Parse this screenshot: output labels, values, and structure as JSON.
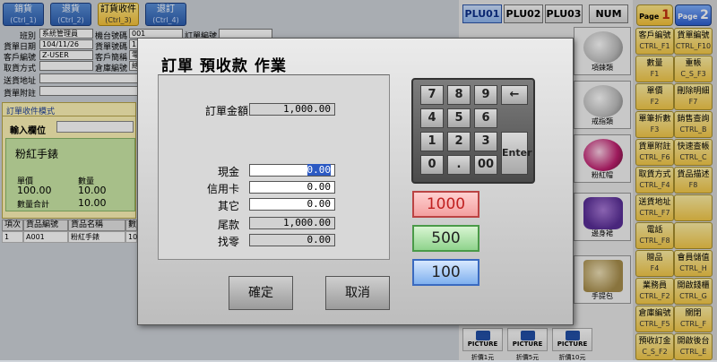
{
  "tabs": [
    {
      "label": "銷貨",
      "key": "(Ctrl_1)"
    },
    {
      "label": "退貨",
      "key": "(Ctrl_2)"
    },
    {
      "label": "訂貨收件",
      "key": "(Ctrl_3)"
    },
    {
      "label": "退訂",
      "key": "(Ctrl_4)"
    }
  ],
  "form": {
    "shift_label": "班別",
    "shift_value": "系統管理員",
    "machine_label": "機台號碼",
    "machine_value": "001",
    "order_no_label": "訂單編號",
    "date_label": "貨單日期",
    "date_value": "104/11/26",
    "sales_no_label": "貨單號碼",
    "sales_no_value": "1",
    "cust_label": "客戶編號",
    "cust_value": "Z-USER",
    "cust_name_label": "客戶簡稱",
    "cust_name_value": "零",
    "pickup_label": "取貨方式",
    "wh_label": "倉庫編號",
    "wh_value": "總",
    "addr_label": "送貨地址",
    "note_label": "貨單附註"
  },
  "order_panel": {
    "title": "訂單收件模式",
    "input_label": "輸入欄位",
    "item_name": "粉紅手錶",
    "price_label": "單價",
    "qty_label": "數量",
    "price_value": "100.00",
    "qty_value": "10.00",
    "qty_total_label": "數量合計",
    "qty_total_value": "10.00"
  },
  "grid": {
    "headers": [
      "項次",
      "貨品編號",
      "貨品名稱",
      "數"
    ],
    "row": [
      "1",
      "A001",
      "粉紅手錶",
      "10"
    ]
  },
  "plu_tabs": [
    "PLU01",
    "PLU02",
    "PLU03",
    "NUM"
  ],
  "page_buttons": [
    {
      "label": "Page",
      "num": "1"
    },
    {
      "label": "Page",
      "num": "2"
    }
  ],
  "products": [
    "項鍊類",
    "戒指類",
    "粉紅帽",
    "邊身裙",
    "手提包"
  ],
  "pictures": [
    {
      "label": "PICTURE",
      "caption": "折價1元"
    },
    {
      "label": "PICTURE",
      "caption": "折價5元"
    },
    {
      "label": "PICTURE",
      "caption": "折價10元"
    }
  ],
  "func_buttons": [
    [
      "客戶編號",
      "CTRL_F1",
      "貨單編號",
      "CTRL_F10"
    ],
    [
      "數量",
      "F1",
      "重帳",
      "C_S_F3"
    ],
    [
      "單價",
      "F2",
      "刪除明細",
      "F7"
    ],
    [
      "單筆折數",
      "F3",
      "銷售查詢",
      "CTRL_B"
    ],
    [
      "貨單附註",
      "CTRL_F6",
      "快速查帳",
      "CTRL_C"
    ],
    [
      "取貨方式",
      "CTRL_F4",
      "貨品描述",
      "F8"
    ],
    [
      "送貨地址",
      "CTRL_F7",
      "",
      ""
    ],
    [
      "電話",
      "CTRL_F8",
      "",
      ""
    ],
    [
      "贈品",
      "F4",
      "會員儲值",
      "CTRL_H"
    ],
    [
      "業務員",
      "CTRL_F2",
      "開啟錢櫃",
      "CTRL_G"
    ],
    [
      "倉庫編號",
      "CTRL_F5",
      "關閉",
      "CTRL_F"
    ],
    [
      "預收訂金",
      "C_S_F2",
      "開啟後台",
      "CTRL_E"
    ]
  ],
  "modal": {
    "title": "訂單 預收款 作業",
    "order_amount_label": "訂單金額",
    "order_amount": "1,000.00",
    "cash_label": "現金",
    "cash": "0.00",
    "card_label": "信用卡",
    "card": "0.00",
    "other_label": "其它",
    "other": "0.00",
    "balance_label": "尾款",
    "balance": "1,000.00",
    "change_label": "找零",
    "change": "0.00",
    "keys": [
      "7",
      "8",
      "9",
      "←",
      "4",
      "5",
      "6",
      "1",
      "2",
      "3",
      "0",
      ".",
      "00"
    ],
    "enter_label": "Enter",
    "quick_amounts": [
      "1000",
      "500",
      "100"
    ],
    "ok_label": "確定",
    "cancel_label": "取消"
  },
  "colors": {
    "money_1000": "#f3a0a0",
    "money_500": "#8fd38c",
    "money_100": "#7fb0ee"
  }
}
